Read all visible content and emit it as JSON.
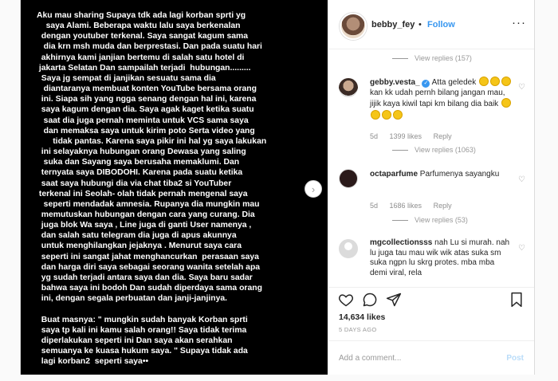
{
  "post": {
    "text": "Aku mau sharing Supaya tdk ada lagi korban sprti yg\n    saya Alami. Beberapa waktu lalu saya berkenalan\n  dengan youtuber terkenal. Saya sangat kagum sama\n   dia krn msh muda dan berprestasi. Dan pada suatu hari\n  akhirnya kami janjian bertemu di salah satu hotel di\n jakarta Selatan Dan sampailah terjadi  hubungan.........\n  Saya jg sempat di janjikan sesuatu sama dia\n   diantaranya membuat konten YouTube bersama orang\n  ini. Siapa sih yang ngga senang dengan hal ini, karena\n  saya kagum dengan dia. Saya agak kaget ketika suatu\n   saat dia juga pernah meminta untuk VCS sama saya\n   dan memaksa saya untuk kirim poto Serta video yang\n       tidak pantas. Karena saya pikir ini hal yg saya lakukan\n  ini selayaknya hubungan orang Dewasa yang saling\n   suka dan Sayang saya berusaha memaklumi. Dan\n  ternyata saya DIBODOHI. Karena pada suatu ketika\n  saat saya hubungi dia via chat tiba2 si YouTuber\n terkenal ini Seolah- olah tidak pernah mengenal saya\n   seperti mendadak amnesia. Rupanya dia mungkin mau\n  memutuskan hubungan dengan cara yang curang. Dia\n  juga blok Wa saya , Line juga di ganti User namenya ,\n  dan salah satu telegram dia juga di apus akunnya\n  untuk menghilangkan jejaknya . Menurut saya cara\n  seperti ini sangat jahat menghancurkan  perasaan saya\n  dan harga diri saya sebagai seorang wanita setelah apa\n  yg sudah terjadi antara saya dan dia. Saya baru sadar\n  bahwa saya ini bodoh Dan sudah diperdaya sama orang\n  ini, dengan segala perbuatan dan janji-janjinya.\n\n  Buat masnya: \" mungkin sudah banyak Korban sprti\n  saya tp kali ini kamu salah orang!! Saya tidak terima\n  diperlakukan seperti ini Dan saya akan serahkan\n  semuanya ke kuasa hukum saya. \" Supaya tidak ada\n  lagi korban2  seperti saya••"
  },
  "header": {
    "username": "bebby_fey",
    "separator": "•",
    "follow_label": "Follow",
    "more_label": "···"
  },
  "comments": {
    "top_view_replies": "View replies (157)",
    "items": [
      {
        "user": "gebby.vesta_",
        "verified": true,
        "text_a": "Atta geledek",
        "text_b": "kan kk udah pernh bilang jangan mau, jijik kaya kiwil tapi km bilang dia baik",
        "time": "5d",
        "likes": "1399 likes",
        "reply": "Reply",
        "view_replies": "View replies (1063)"
      },
      {
        "user": "octaparfume",
        "text": "Parfumenya sayangku",
        "time": "5d",
        "likes": "1686 likes",
        "reply": "Reply",
        "view_replies": "View replies (53)"
      },
      {
        "user": "mgcollectionsss",
        "text": "nah Lu si murah. nah lu juga tau mau wik wik atas suka sm suka ngpn lu skrg protes. mba mba demi viral, rela"
      }
    ]
  },
  "stats": {
    "likes": "14,634 likes",
    "ago": "5 DAYS AGO"
  },
  "add_comment": {
    "placeholder": "Add a comment...",
    "post_label": "Post"
  },
  "colors": {
    "accent": "#3897f0",
    "muted": "#8e8e8e",
    "text": "#262626"
  }
}
